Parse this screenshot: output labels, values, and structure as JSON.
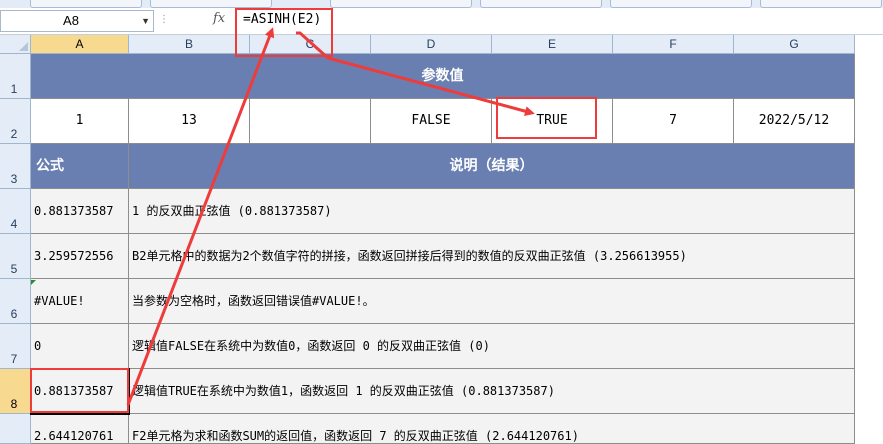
{
  "formula_bar": {
    "name_box": "A8",
    "fx_label": "fx",
    "formula": "=ASINH(E2)"
  },
  "columns": [
    "A",
    "B",
    "C",
    "D",
    "E",
    "F",
    "G"
  ],
  "rows": [
    "1",
    "2",
    "3",
    "4",
    "5",
    "6",
    "7",
    "8"
  ],
  "sheet": {
    "title": "参数值",
    "params": [
      "1",
      "13",
      "",
      "FALSE",
      "TRUE",
      "7",
      "2022/5/12"
    ],
    "col_formula": "公式",
    "col_desc": "说明（结果）",
    "results": [
      {
        "result": "0.881373587",
        "desc": "1 的反双曲正弦值 (0.881373587)"
      },
      {
        "result": "3.259572556",
        "desc": "B2单元格中的数据为2个数值字符的拼接，函数返回拼接后得到的数值的反双曲正弦值 (3.256613955)"
      },
      {
        "result": "#VALUE!",
        "desc": "当参数为空格时，函数返回错误值#VALUE!。"
      },
      {
        "result": "0",
        "desc": "逻辑值FALSE在系统中为数值0，函数返回 0 的反双曲正弦值 (0)"
      },
      {
        "result": "0.881373587",
        "desc": "逻辑值TRUE在系统中为数值1，函数返回 1 的反双曲正弦值 (0.881373587)"
      },
      {
        "result": "2.644120761",
        "desc": "F2单元格为求和函数SUM的返回值，函数返回 7 的反双曲正弦值 (2.644120761)"
      }
    ]
  },
  "colors": {
    "header_fill": "#6a7fb1",
    "annotation_red": "#ee3b3b",
    "selection_header": "#f8d990"
  }
}
